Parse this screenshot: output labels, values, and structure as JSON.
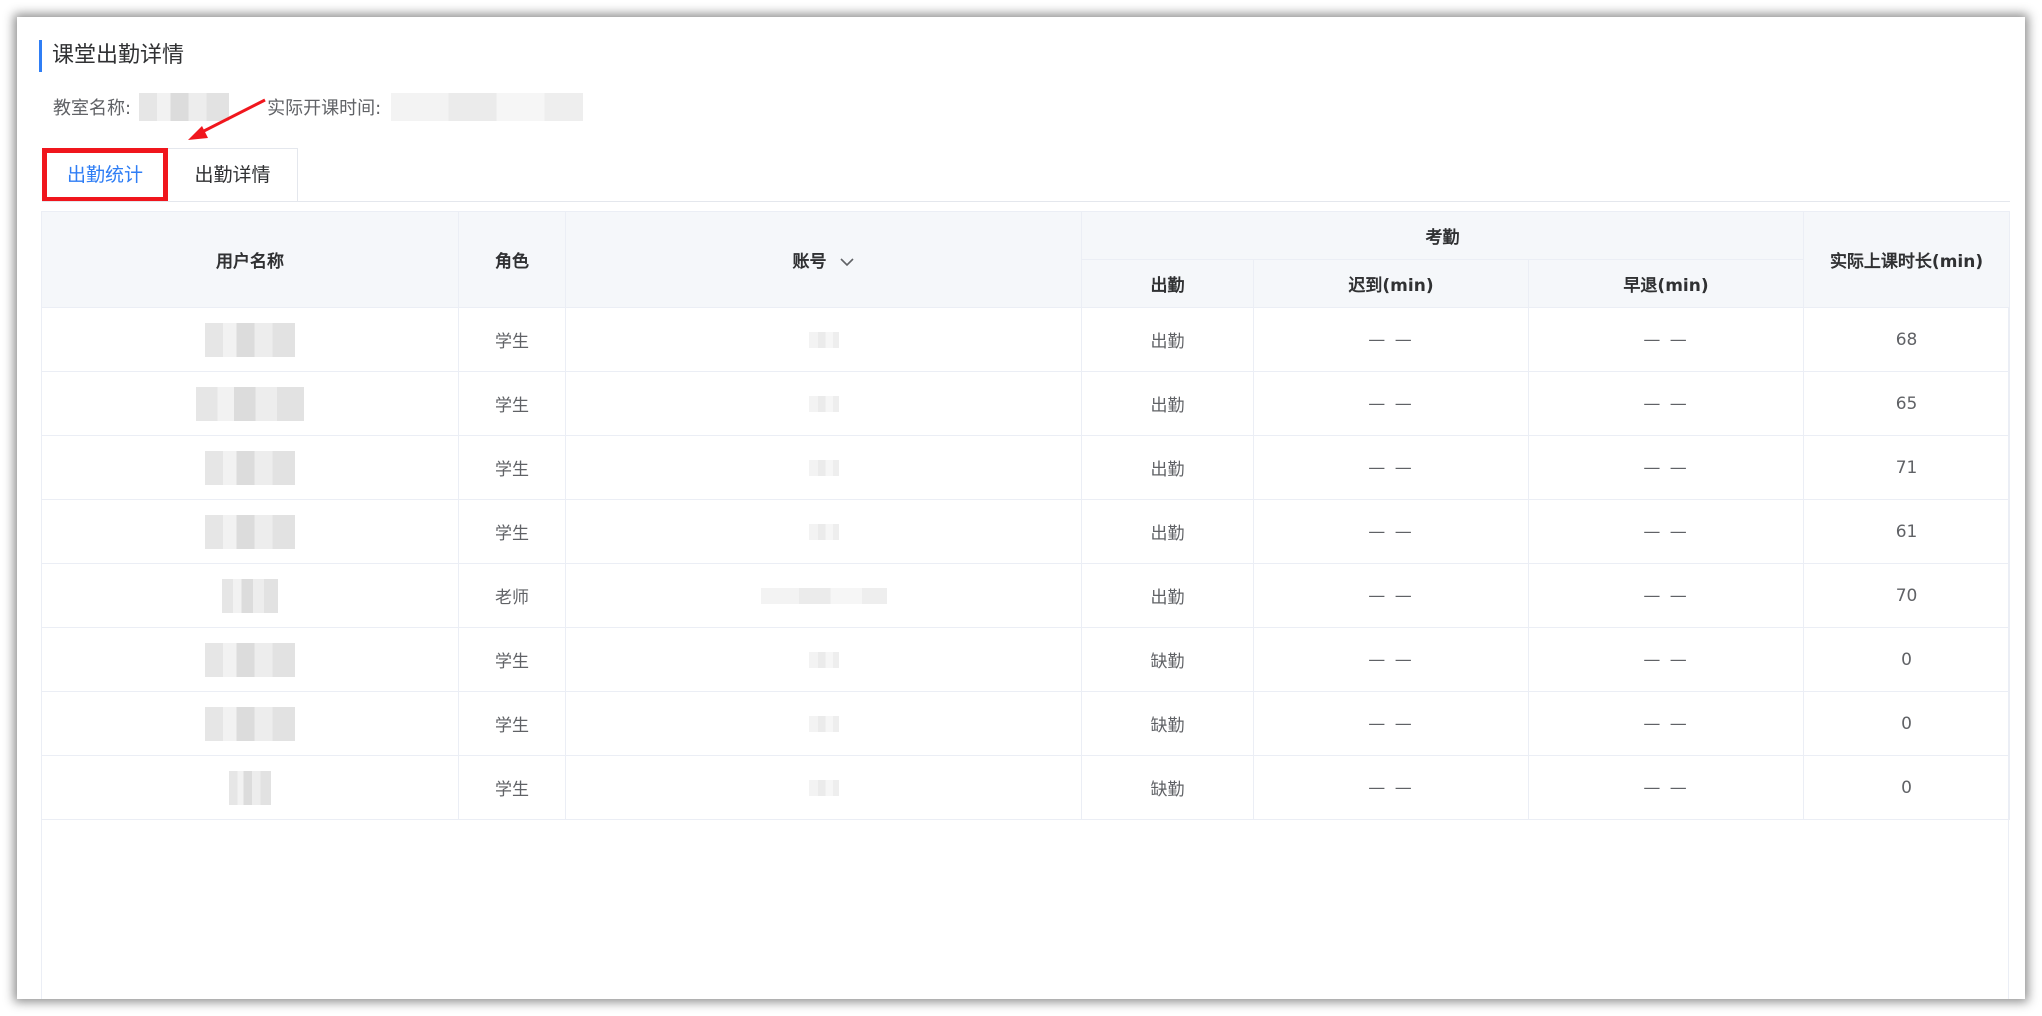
{
  "page": {
    "title": "课堂出勤详情",
    "classroom_label": "教室名称:",
    "start_time_label": "实际开课时间:"
  },
  "tabs": [
    {
      "label": "出勤统计",
      "active": true
    },
    {
      "label": "出勤详情",
      "active": false
    }
  ],
  "table": {
    "headers": {
      "username": "用户名称",
      "role": "角色",
      "account": "账号",
      "attendance_group": "考勤",
      "attendance": "出勤",
      "late": "迟到(min)",
      "early_leave": "早退(min)",
      "duration": "实际上课时长(min)"
    },
    "rows": [
      {
        "role": "学生",
        "attendance": "出勤",
        "late": "— —",
        "early": "— —",
        "duration": "68"
      },
      {
        "role": "学生",
        "attendance": "出勤",
        "late": "— —",
        "early": "— —",
        "duration": "65"
      },
      {
        "role": "学生",
        "attendance": "出勤",
        "late": "— —",
        "early": "— —",
        "duration": "71"
      },
      {
        "role": "学生",
        "attendance": "出勤",
        "late": "— —",
        "early": "— —",
        "duration": "61"
      },
      {
        "role": "老师",
        "attendance": "出勤",
        "late": "— —",
        "early": "— —",
        "duration": "70"
      },
      {
        "role": "学生",
        "attendance": "缺勤",
        "late": "— —",
        "early": "— —",
        "duration": "0"
      },
      {
        "role": "学生",
        "attendance": "缺勤",
        "late": "— —",
        "early": "— —",
        "duration": "0"
      },
      {
        "role": "学生",
        "attendance": "缺勤",
        "late": "— —",
        "early": "— —",
        "duration": "0"
      }
    ]
  },
  "colors": {
    "accent": "#2f7ef5",
    "absent": "#f56c6c",
    "highlight_box": "#f0161d"
  },
  "icons": {
    "sort": "chevron-down-icon",
    "annotation": "red-arrow-icon"
  }
}
